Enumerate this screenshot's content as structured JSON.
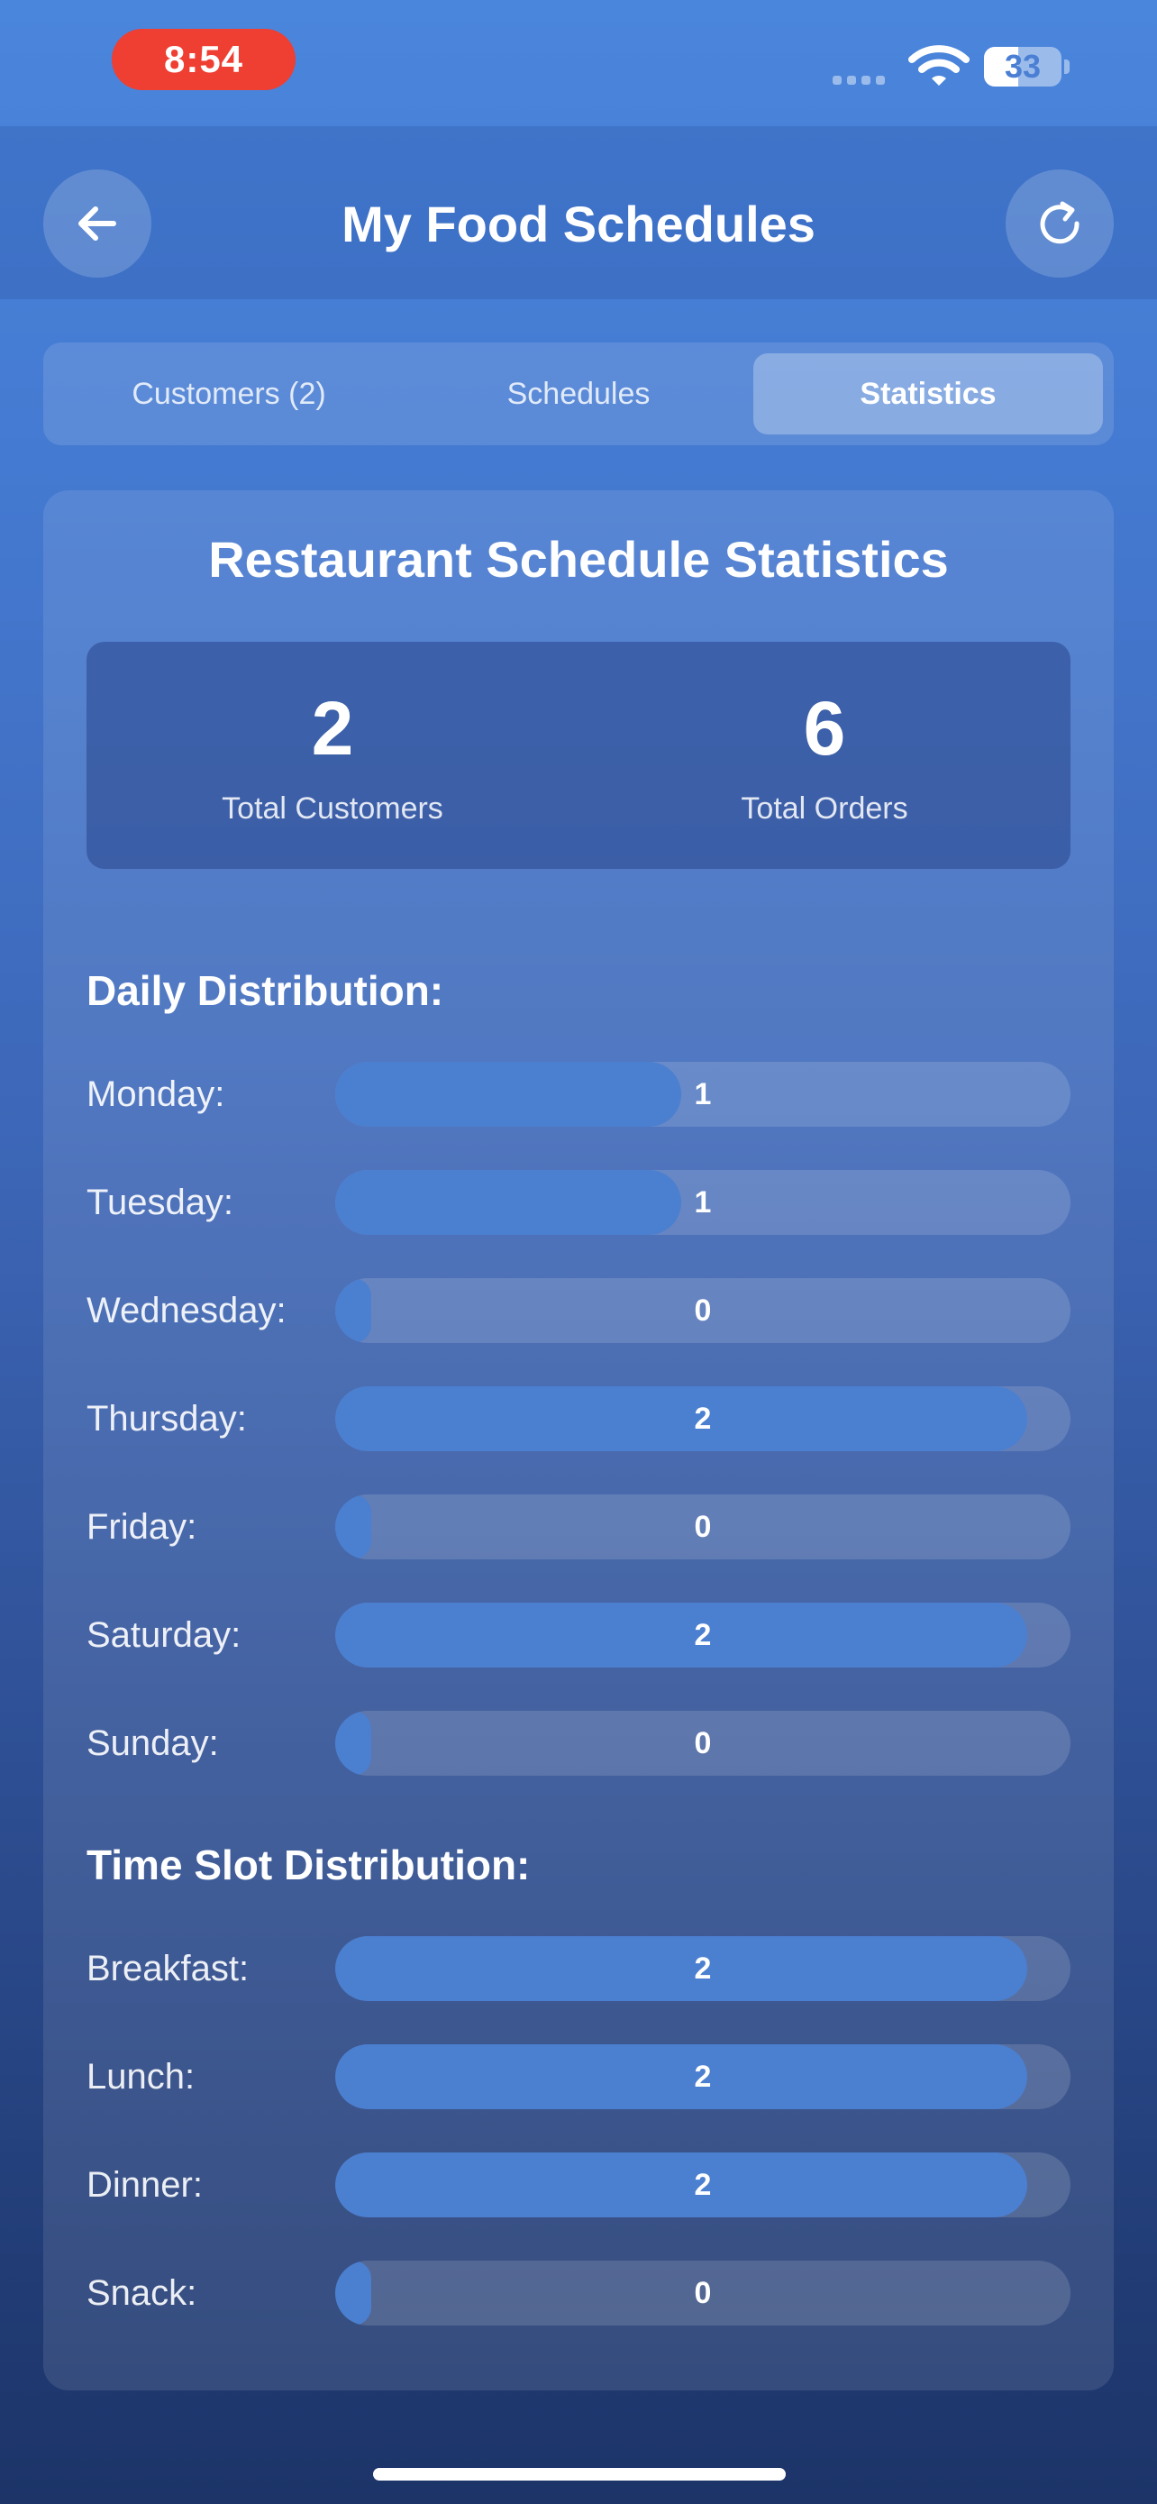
{
  "status_bar": {
    "time": "8:54",
    "battery": "33"
  },
  "header": {
    "title": "My Food Schedules"
  },
  "tabs": [
    {
      "label": "Customers (2)"
    },
    {
      "label": "Schedules"
    },
    {
      "label": "Statistics"
    }
  ],
  "stats": {
    "title": "Restaurant Schedule Statistics",
    "total_customers": {
      "value": "2",
      "label": "Total Customers"
    },
    "total_orders": {
      "value": "6",
      "label": "Total Orders"
    },
    "daily_title": "Daily Distribution:",
    "daily": [
      {
        "label": "Monday:",
        "value": 1
      },
      {
        "label": "Tuesday:",
        "value": 1
      },
      {
        "label": "Wednesday:",
        "value": 0
      },
      {
        "label": "Thursday:",
        "value": 2
      },
      {
        "label": "Friday:",
        "value": 0
      },
      {
        "label": "Saturday:",
        "value": 2
      },
      {
        "label": "Sunday:",
        "value": 0
      }
    ],
    "timeslot_title": "Time Slot Distribution:",
    "timeslot": [
      {
        "label": "Breakfast:",
        "value": 2
      },
      {
        "label": "Lunch:",
        "value": 2
      },
      {
        "label": "Dinner:",
        "value": 2
      },
      {
        "label": "Snack:",
        "value": 0
      }
    ],
    "scale_max": 2
  }
}
